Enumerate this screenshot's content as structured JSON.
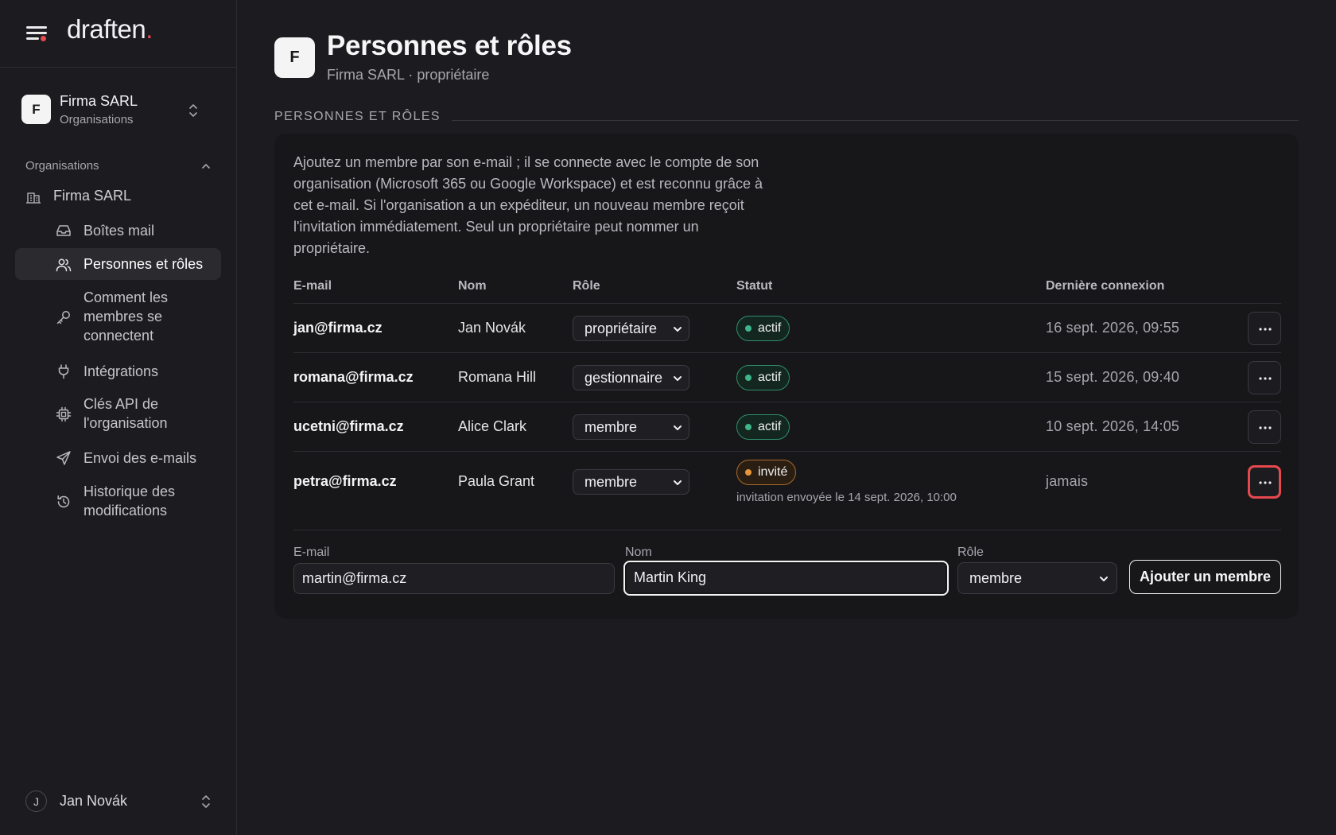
{
  "brand": {
    "name": "draften",
    "dot": "."
  },
  "org_switcher": {
    "avatar": "F",
    "name": "Firma SARL",
    "subtitle": "Organisations"
  },
  "sidebar": {
    "section_label": "Organisations",
    "org_item": "Firma SARL",
    "items": [
      {
        "label": "Boîtes mail",
        "icon": "inbox-icon"
      },
      {
        "label": "Personnes et rôles",
        "icon": "users-icon",
        "active": true
      },
      {
        "label": "Comment les membres se connectent",
        "icon": "key-icon"
      },
      {
        "label": "Intégrations",
        "icon": "plug-icon"
      },
      {
        "label": "Clés API de l'organisation",
        "icon": "chip-icon"
      },
      {
        "label": "Envoi des e-mails",
        "icon": "send-icon"
      },
      {
        "label": "Historique des modifications",
        "icon": "history-icon"
      }
    ]
  },
  "user": {
    "initial": "J",
    "name": "Jan Novák"
  },
  "page": {
    "avatar": "F",
    "title": "Personnes et rôles",
    "subtitle": "Firma SARL · propriétaire",
    "section_title": "PERSONNES ET RÔLES",
    "intro": "Ajoutez un membre par son e-mail ; il se connecte avec le compte de son organisation (Microsoft 365 ou Google Workspace) et est reconnu grâce à cet e-mail. Si l'organisation a un expéditeur, un nouveau membre reçoit l'invitation immédiatement. Seul un propriétaire peut nommer un propriétaire."
  },
  "table": {
    "headers": {
      "email": "E-mail",
      "name": "Nom",
      "role": "Rôle",
      "status": "Statut",
      "last_login": "Dernière connexion"
    },
    "rows": [
      {
        "email": "jan@firma.cz",
        "name": "Jan Novák",
        "role": "propriétaire",
        "status": "actif",
        "last_login": "16 sept. 2026, 09:55"
      },
      {
        "email": "romana@firma.cz",
        "name": "Romana Hill",
        "role": "gestionnaire",
        "status": "actif",
        "last_login": "15 sept. 2026, 09:40"
      },
      {
        "email": "ucetni@firma.cz",
        "name": "Alice Clark",
        "role": "membre",
        "status": "actif",
        "last_login": "10 sept. 2026, 14:05"
      },
      {
        "email": "petra@firma.cz",
        "name": "Paula Grant",
        "role": "membre",
        "status": "invité",
        "note": "invitation envoyée le 14 sept. 2026, 10:00",
        "last_login": "jamais"
      }
    ]
  },
  "add_form": {
    "email_label": "E-mail",
    "email_value": "martin@firma.cz",
    "name_label": "Nom",
    "name_value": "Martin King",
    "role_label": "Rôle",
    "role_value": "membre",
    "submit": "Ajouter un membre"
  },
  "colors": {
    "accent_red": "#e5484d",
    "active_green": "#3fb58a",
    "invited_orange": "#e8963d",
    "background": "#1c1c20"
  }
}
